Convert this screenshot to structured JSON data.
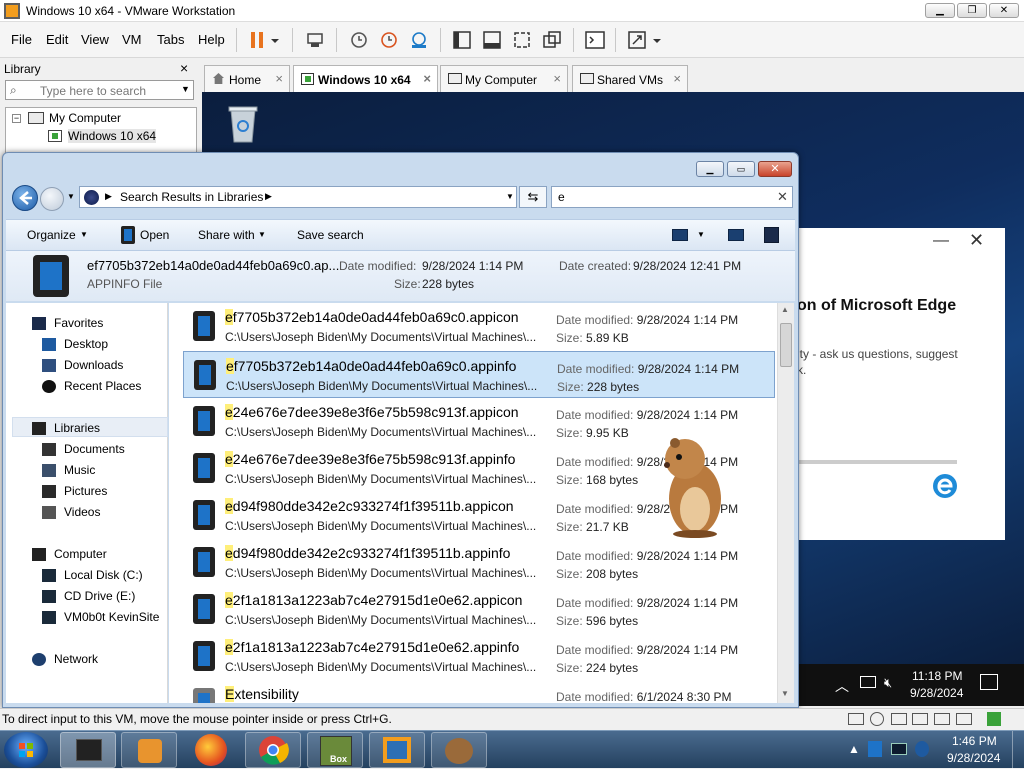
{
  "vmware": {
    "title": "Windows 10 x64 - VMware Workstation",
    "menu": [
      "File",
      "Edit",
      "View",
      "VM",
      "Tabs",
      "Help"
    ],
    "library_label": "Library",
    "library_close": "×",
    "search_placeholder": "Type here to search",
    "tree": {
      "root": "My Computer",
      "child": "Windows 10 x64"
    },
    "tabs": [
      {
        "label": "Home"
      },
      {
        "label": "Windows 10 x64"
      },
      {
        "label": "My Computer"
      },
      {
        "label": "Shared VMs"
      }
    ],
    "tab_close": "×",
    "status_text": "To direct input to this VM, move the mouse pointer inside or press Ctrl+G."
  },
  "guest": {
    "edge_card_title": "on of Microsoft Edge",
    "edge_card_text1": "ity - ask us questions, suggest",
    "edge_card_text2": "k.",
    "clock_time": "11:18 PM",
    "clock_date": "9/28/2024"
  },
  "explorer": {
    "address": "Search Results in Libraries",
    "search_value": "e",
    "commands": {
      "organize": "Organize",
      "open": "Open",
      "share_with": "Share with",
      "save_search": "Save search"
    },
    "details": {
      "name": "ef7705b372eb14a0de0ad44feb0a69c0.ap...",
      "type": "APPINFO File",
      "modified_label": "Date modified:",
      "modified_value": "9/28/2024 1:14 PM",
      "size_label": "Size:",
      "size_value": "228 bytes",
      "created_label": "Date created:",
      "created_value": "9/28/2024 12:41 PM"
    },
    "nav": {
      "favorites": "Favorites",
      "desktop": "Desktop",
      "downloads": "Downloads",
      "recent": "Recent Places",
      "libraries": "Libraries",
      "documents": "Documents",
      "music": "Music",
      "pictures": "Pictures",
      "videos": "Videos",
      "computer": "Computer",
      "local_disk": "Local Disk (C:)",
      "cd_drive": "CD Drive (E:)",
      "vm_share": "VM0b0t KevinSite",
      "network": "Network"
    },
    "modified_label": "Date modified:",
    "size_label": "Size:",
    "path": "C:\\Users\\Joseph Biden\\My Documents\\Virtual Machines\\...",
    "files": [
      {
        "first": "e",
        "rest": "f7705b372eb14a0de0ad44feb0a69c0.appicon",
        "modified": "9/28/2024 1:14 PM",
        "size": "5.89 KB"
      },
      {
        "first": "e",
        "rest": "f7705b372eb14a0de0ad44feb0a69c0.appinfo",
        "modified": "9/28/2024 1:14 PM",
        "size": "228 bytes"
      },
      {
        "first": "e",
        "rest": "24e676e7dee39e8e3f6e75b598c913f.appicon",
        "modified": "9/28/2024 1:14 PM",
        "size": "9.95 KB"
      },
      {
        "first": "e",
        "rest": "24e676e7dee39e8e3f6e75b598c913f.appinfo",
        "modified": "9/28/2024 1:14 PM",
        "size": "168 bytes"
      },
      {
        "first": "e",
        "rest": "d94f980dde342e2c933274f1f39511b.appicon",
        "modified": "9/28/2024 1:14 PM",
        "size": "21.7 KB"
      },
      {
        "first": "e",
        "rest": "d94f980dde342e2c933274f1f39511b.appinfo",
        "modified": "9/28/2024 1:14 PM",
        "size": "208 bytes"
      },
      {
        "first": "e",
        "rest": "2f1a1813a1223ab7c4e27915d1e0e62.appicon",
        "modified": "9/28/2024 1:14 PM",
        "size": "596 bytes"
      },
      {
        "first": "e",
        "rest": "2f1a1813a1223ab7c4e27915d1e0e62.appinfo",
        "modified": "9/28/2024 1:14 PM",
        "size": "224 bytes"
      },
      {
        "first": "E",
        "rest": "xtensibility",
        "modified": "6/1/2024 8:30 PM",
        "size": ""
      }
    ]
  },
  "host_taskbar": {
    "clock_time": "1:46 PM",
    "clock_date": "9/28/2024",
    "box_label": "Box"
  }
}
